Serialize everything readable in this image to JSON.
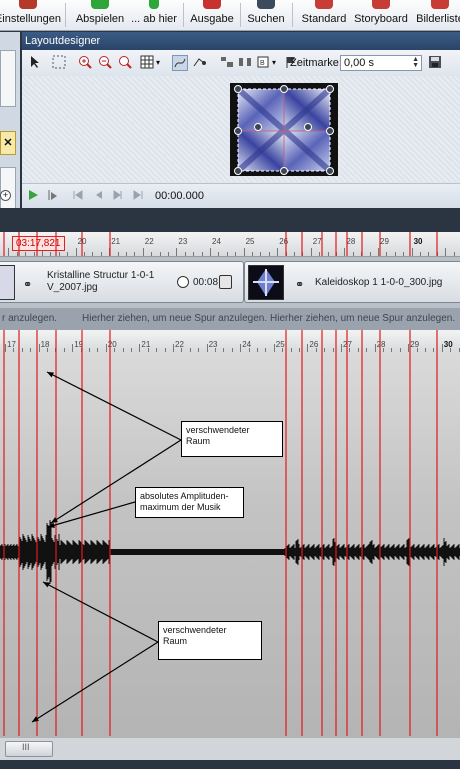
{
  "toolbar": {
    "items": [
      {
        "label": "Einstellungen",
        "icon": "settings-icon"
      },
      {
        "label": "Abspielen",
        "icon": "play-icon"
      },
      {
        "label": "... ab hier",
        "icon": "play-from-here-icon"
      },
      {
        "label": "Ausgabe",
        "icon": "output-icon"
      },
      {
        "label": "Suchen",
        "icon": "search-icon"
      },
      {
        "label": "Standard",
        "icon": "standard-view-icon"
      },
      {
        "label": "Storyboard",
        "icon": "storyboard-icon"
      },
      {
        "label": "Bilderliste",
        "icon": "image-list-icon"
      }
    ]
  },
  "layout_designer": {
    "title": "Layoutdesigner",
    "zeitmarke_label": "Zeitmarke:",
    "zeitmarke_value": "0,00 s",
    "timecode": "00:00.000"
  },
  "timeline": {
    "position_badge": "03:17,821",
    "ruler_top_numbers": [
      "19",
      "20",
      "21",
      "22",
      "23",
      "24",
      "25",
      "26",
      "27",
      "28",
      "29",
      "30"
    ],
    "ruler_bottom_numbers": [
      "17",
      "18",
      "19",
      "20",
      "21",
      "22",
      "23",
      "24",
      "25",
      "26",
      "27",
      "28",
      "29",
      "30"
    ],
    "clips": [
      {
        "name_line1": "Kristalline Structur 1-0-1",
        "name_line2": "V_2007.jpg",
        "duration": "00:08"
      },
      {
        "name_line1": "Kaleidoskop 1 1-0-0_300.jpg"
      }
    ],
    "hint_text": "Hierher ziehen, um neue Spur anzulegen.",
    "hint_text_cut": "r anzulegen."
  },
  "annotations": [
    {
      "text_line1": "verschwendeter",
      "text_line2": "Raum"
    },
    {
      "text_line1": "absolutes Amplituden-",
      "text_line2": "maximum der Musik"
    },
    {
      "text_line1": "verschwendeter",
      "text_line2": "Raum"
    }
  ],
  "scrollbar": {
    "thumb_label": "III"
  },
  "colors": {
    "marker_line": "#e0191b",
    "panel_title": "#2f4c74",
    "badge_text": "#cc0000"
  }
}
